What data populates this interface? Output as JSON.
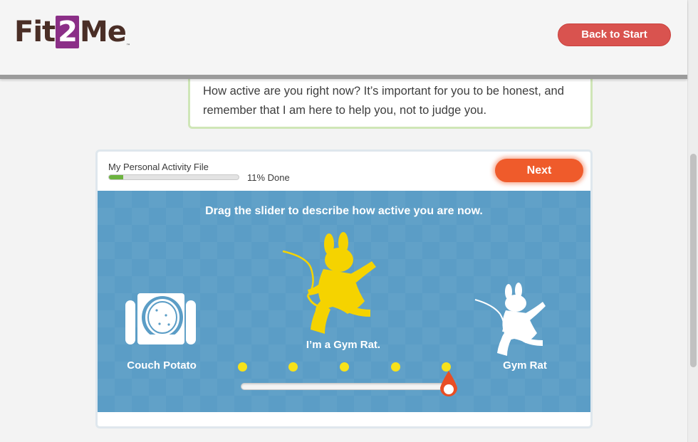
{
  "header": {
    "logo_text_a": "Fit",
    "logo_text_two": "2",
    "logo_text_b": "Me",
    "logo_tm": "™",
    "back_label": "Back to Start"
  },
  "bubble": {
    "message": "How active are you right now? It’s important for you to be honest, and remember that I am here to help you, not to judge you."
  },
  "card": {
    "file_title": "My Personal Activity File",
    "progress_percent": 11,
    "done_label": "11% Done",
    "next_label": "Next"
  },
  "slider": {
    "instruction": "Drag the slider to describe how active you are now.",
    "left_label": "Couch Potato",
    "right_label": "Gym Rat",
    "current_label": "I’m a Gym Rat.",
    "steps": 5,
    "selected_step": 5
  },
  "colors": {
    "accent_orange": "#ef5b2b",
    "back_red": "#d9534f",
    "stage_blue": "#5b9dc6",
    "rat_yellow": "#f5d300",
    "progress_green": "#6cb33f",
    "logo_purple": "#8b2f87"
  },
  "icons": {
    "couch": "couch-potato-icon",
    "rat_selected": "gym-rat-yellow-icon",
    "rat_end": "gym-rat-white-icon",
    "handle": "slider-handle-icon"
  }
}
